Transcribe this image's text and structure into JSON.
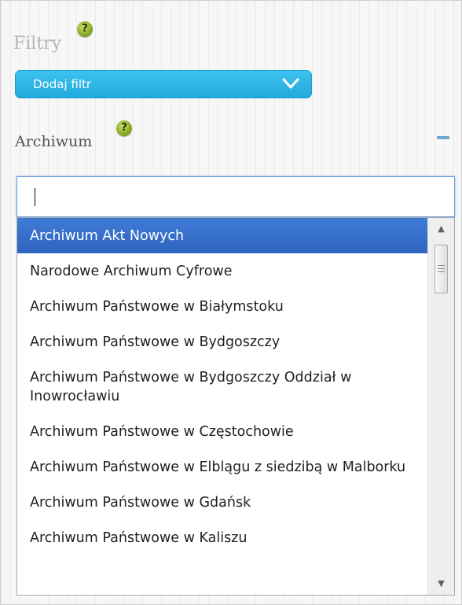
{
  "filters": {
    "title": "Filtry",
    "help_icon": "question-mark-icon",
    "add_filter_label": "Dodaj filtr"
  },
  "archive": {
    "title": "Archiwum",
    "help_icon": "question-mark-icon",
    "search": {
      "value": "",
      "placeholder": ""
    },
    "options": [
      {
        "label": "Archiwum Akt Nowych",
        "selected": true
      },
      {
        "label": "Narodowe Archiwum Cyfrowe"
      },
      {
        "label": "Archiwum Państwowe w Białymstoku"
      },
      {
        "label": "Archiwum Państwowe w Bydgoszczy"
      },
      {
        "label": "Archiwum Państwowe w Bydgoszczy Oddział w Inowrocławiu"
      },
      {
        "label": "Archiwum Państwowe w Częstochowie"
      },
      {
        "label": "Archiwum Państwowe w Elblągu z siedzibą w Malborku"
      },
      {
        "label": "Archiwum Państwowe w Gdańsk"
      },
      {
        "label": "Archiwum Państwowe w Kaliszu"
      }
    ]
  },
  "colors": {
    "accent": "#22a9dc",
    "selection": "#3474d0",
    "help_icon": "#8fb32a"
  }
}
